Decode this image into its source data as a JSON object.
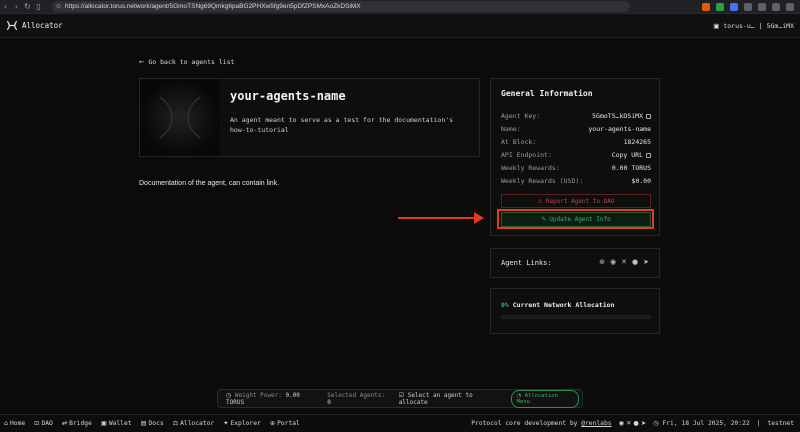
{
  "browser": {
    "url": "https://allocator.torus.network/agent/5GmoTSNg69Qmkg6paBG2PHXw5fg9en5pDfZPSMxAoZkDSiMX"
  },
  "header": {
    "app_title": "Allocator",
    "wallet_name": "torus-u…",
    "wallet_address": "5Gm…iMX"
  },
  "back_link": "Go back to agents list",
  "agent": {
    "name": "your-agents-name",
    "description": "An agent meant to serve as a test for the documentation's how-to-tutorial",
    "documentation": "Documentation of the agent, can contain link."
  },
  "general_info": {
    "title": "General Information",
    "rows": [
      {
        "key": "Agent Key:",
        "value": "5GmoTS…kDSiMX"
      },
      {
        "key": "Name:",
        "value": "your-agents-name"
      },
      {
        "key": "At Block:",
        "value": "1824265"
      },
      {
        "key": "API Endpoint:",
        "value": "Copy URL"
      },
      {
        "key": "Weekly Rewards:",
        "value": "0.00 TORUS"
      },
      {
        "key": "Weekly Rewards (USD):",
        "value": "$0.00"
      }
    ],
    "report_label": "Report Agent to DAO",
    "update_label": "Update Agent Info"
  },
  "agent_links": {
    "label": "Agent Links:"
  },
  "network_allocation": {
    "percent": "0%",
    "label": "Current Network Allocation"
  },
  "allocation_bar": {
    "weight_power_label": "Weight Power:",
    "weight_power_value": "0.00 TORUS",
    "selected_agents_label": "Selected Agents:",
    "selected_agents_value": "0",
    "select_text": "Select an agent to allocate",
    "menu_label": "Allocation Menu"
  },
  "footer": {
    "links": [
      "Home",
      "DAO",
      "Bridge",
      "Wallet",
      "Docs",
      "Allocator",
      "Explorer",
      "Portal"
    ],
    "credit_text": "Protocol core development by",
    "credit_link": "@renlabs",
    "datetime": "Fri, 18 Jul 2025, 20:22",
    "network": "testnet"
  },
  "colors": {
    "accent_green": "#3db06a",
    "danger_red": "#c24646",
    "highlight_red": "#e03b24"
  }
}
